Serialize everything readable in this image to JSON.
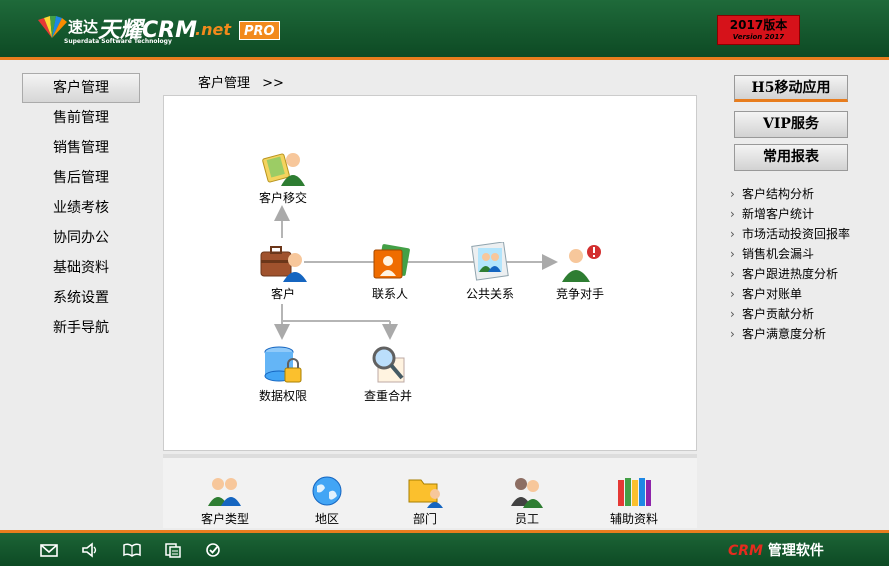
{
  "header": {
    "logo_cn": "速达",
    "logo_big": "天耀CRM",
    "logo_net": ".net",
    "logo_pro": "PRO",
    "logo_sub": "Superdata Software Technology",
    "version_line1": "2017版本",
    "version_line2": "Version 2017"
  },
  "nav": {
    "items": [
      {
        "label": "客户管理"
      },
      {
        "label": "售前管理"
      },
      {
        "label": "销售管理"
      },
      {
        "label": "售后管理"
      },
      {
        "label": "业绩考核"
      },
      {
        "label": "协同办公"
      },
      {
        "label": "基础资料"
      },
      {
        "label": "系统设置"
      },
      {
        "label": "新手导航"
      }
    ]
  },
  "breadcrumb": {
    "current": "客户管理",
    "separator": ">>"
  },
  "flow": {
    "transfer": "客户移交",
    "customer": "客户",
    "contact": "联系人",
    "public_relation": "公共关系",
    "competitor": "竞争对手",
    "data_permission": "数据权限",
    "dedupe_merge": "查重合并"
  },
  "bottom": {
    "items": [
      {
        "label": "客户类型"
      },
      {
        "label": "地区"
      },
      {
        "label": "部门"
      },
      {
        "label": "员工"
      },
      {
        "label": "辅助资料"
      }
    ]
  },
  "right": {
    "btn_h5": "H5移动应用",
    "btn_vip": "VIP服务",
    "btn_reports": "常用报表",
    "reports": [
      {
        "label": "客户结构分析"
      },
      {
        "label": "新增客户统计"
      },
      {
        "label": "市场活动投资回报率"
      },
      {
        "label": "销售机会漏斗"
      },
      {
        "label": "客户跟进热度分析"
      },
      {
        "label": "客户对账单"
      },
      {
        "label": "客户贡献分析"
      },
      {
        "label": "客户满意度分析"
      }
    ]
  },
  "footer": {
    "brand_crm": "CRM",
    "brand_text": " 管理软件"
  },
  "colors": {
    "header_green": "#1f6a3a",
    "accent_orange": "#e87d1e",
    "version_red": "#d6121a"
  }
}
